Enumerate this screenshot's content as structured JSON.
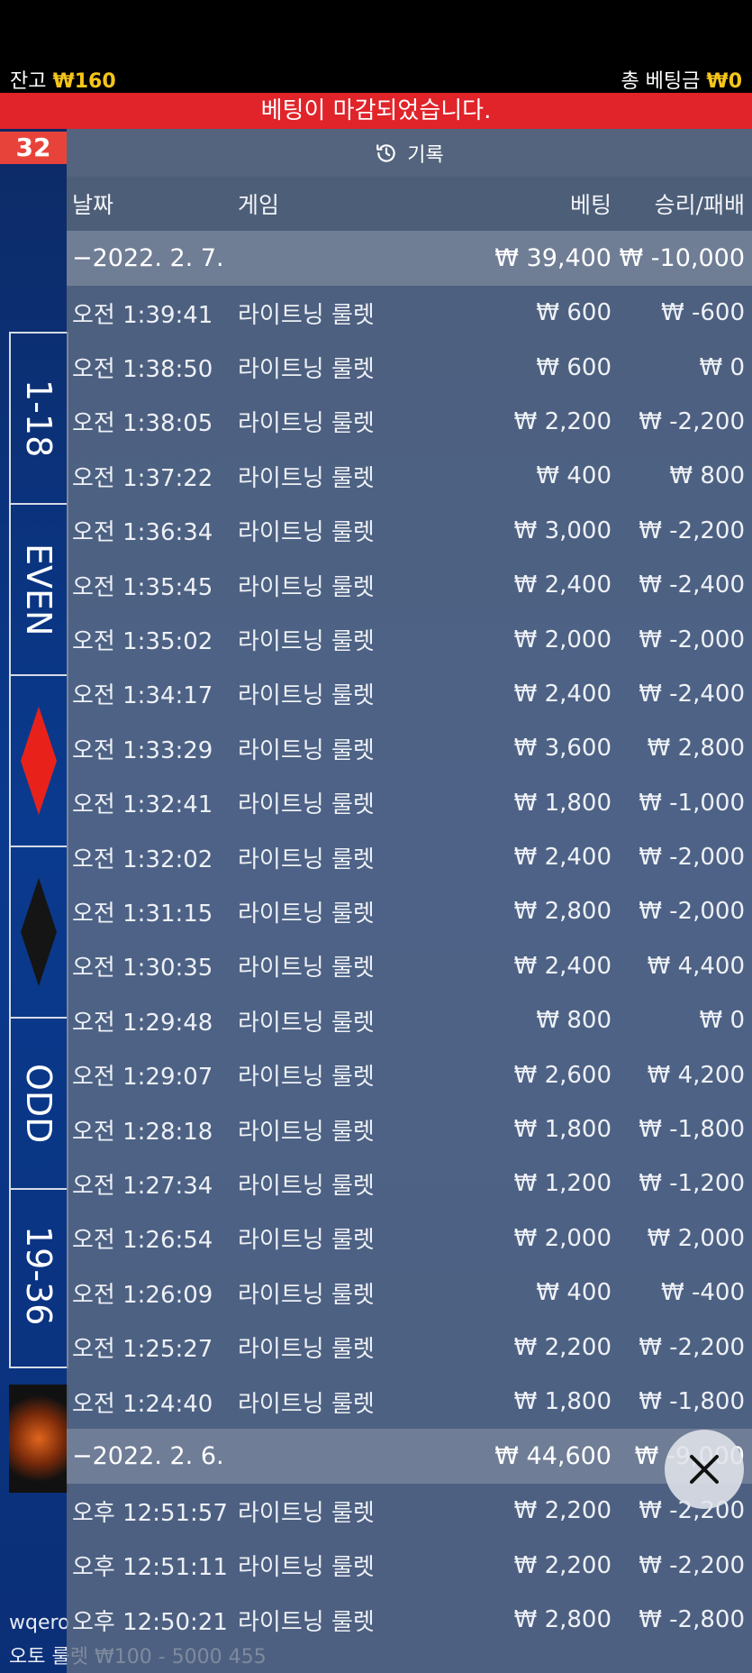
{
  "topbar": {
    "balance_label": "잔고",
    "balance_value": "₩160",
    "total_bet_label": "총 베팅금",
    "total_bet_value": "₩0"
  },
  "banner": {
    "text": "베팅이 마감되었습니다."
  },
  "game": {
    "last_number": "32",
    "user": "wqero",
    "title": "오토 룰렛 ₩100 - 5000 455"
  },
  "bet_cells": [
    "1-18",
    "EVEN",
    "",
    "",
    "ODD",
    "19-36"
  ],
  "panel": {
    "title": "기록",
    "icon": "clock-history-icon"
  },
  "columns": {
    "date": "날짜",
    "game": "게임",
    "bet": "베팅",
    "win": "승리/패배"
  },
  "groups": [
    {
      "date": "−2022. 2. 7.",
      "bet": "₩ 39,400",
      "win": "₩ -10,000",
      "rows": [
        {
          "time": "오전 1:39:41",
          "game": "라이트닝 룰렛",
          "bet": "₩ 600",
          "win": "₩ -600"
        },
        {
          "time": "오전 1:38:50",
          "game": "라이트닝 룰렛",
          "bet": "₩ 600",
          "win": "₩ 0"
        },
        {
          "time": "오전 1:38:05",
          "game": "라이트닝 룰렛",
          "bet": "₩ 2,200",
          "win": "₩ -2,200"
        },
        {
          "time": "오전 1:37:22",
          "game": "라이트닝 룰렛",
          "bet": "₩ 400",
          "win": "₩ 800"
        },
        {
          "time": "오전 1:36:34",
          "game": "라이트닝 룰렛",
          "bet": "₩ 3,000",
          "win": "₩ -2,200"
        },
        {
          "time": "오전 1:35:45",
          "game": "라이트닝 룰렛",
          "bet": "₩ 2,400",
          "win": "₩ -2,400"
        },
        {
          "time": "오전 1:35:02",
          "game": "라이트닝 룰렛",
          "bet": "₩ 2,000",
          "win": "₩ -2,000"
        },
        {
          "time": "오전 1:34:17",
          "game": "라이트닝 룰렛",
          "bet": "₩ 2,400",
          "win": "₩ -2,400"
        },
        {
          "time": "오전 1:33:29",
          "game": "라이트닝 룰렛",
          "bet": "₩ 3,600",
          "win": "₩ 2,800"
        },
        {
          "time": "오전 1:32:41",
          "game": "라이트닝 룰렛",
          "bet": "₩ 1,800",
          "win": "₩ -1,000"
        },
        {
          "time": "오전 1:32:02",
          "game": "라이트닝 룰렛",
          "bet": "₩ 2,400",
          "win": "₩ -2,000"
        },
        {
          "time": "오전 1:31:15",
          "game": "라이트닝 룰렛",
          "bet": "₩ 2,800",
          "win": "₩ -2,000"
        },
        {
          "time": "오전 1:30:35",
          "game": "라이트닝 룰렛",
          "bet": "₩ 2,400",
          "win": "₩ 4,400"
        },
        {
          "time": "오전 1:29:48",
          "game": "라이트닝 룰렛",
          "bet": "₩ 800",
          "win": "₩ 0"
        },
        {
          "time": "오전 1:29:07",
          "game": "라이트닝 룰렛",
          "bet": "₩ 2,600",
          "win": "₩ 4,200"
        },
        {
          "time": "오전 1:28:18",
          "game": "라이트닝 룰렛",
          "bet": "₩ 1,800",
          "win": "₩ -1,800"
        },
        {
          "time": "오전 1:27:34",
          "game": "라이트닝 룰렛",
          "bet": "₩ 1,200",
          "win": "₩ -1,200"
        },
        {
          "time": "오전 1:26:54",
          "game": "라이트닝 룰렛",
          "bet": "₩ 2,000",
          "win": "₩ 2,000"
        },
        {
          "time": "오전 1:26:09",
          "game": "라이트닝 룰렛",
          "bet": "₩ 400",
          "win": "₩ -400"
        },
        {
          "time": "오전 1:25:27",
          "game": "라이트닝 룰렛",
          "bet": "₩ 2,200",
          "win": "₩ -2,200"
        },
        {
          "time": "오전 1:24:40",
          "game": "라이트닝 룰렛",
          "bet": "₩ 1,800",
          "win": "₩ -1,800"
        }
      ]
    },
    {
      "date": "−2022. 2. 6.",
      "bet": "₩ 44,600",
      "win": "₩ -9,000",
      "rows": [
        {
          "time": "오후 12:51:57",
          "game": "라이트닝 룰렛",
          "bet": "₩ 2,200",
          "win": "₩ -2,200"
        },
        {
          "time": "오후 12:51:11",
          "game": "라이트닝 룰렛",
          "bet": "₩ 2,200",
          "win": "₩ -2,200"
        },
        {
          "time": "오후 12:50:21",
          "game": "라이트닝 룰렛",
          "bet": "₩ 2,800",
          "win": "₩ -2,800"
        }
      ]
    }
  ],
  "close_button": {
    "icon": "close-icon"
  }
}
